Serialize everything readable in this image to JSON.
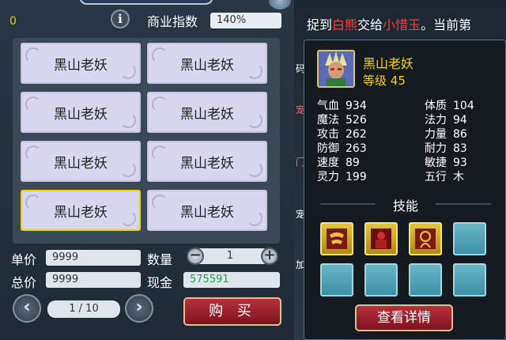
{
  "shop": {
    "top_value": "0",
    "business_index_label": "商业指数",
    "business_index_value": "140%",
    "items": [
      {
        "name": "黑山老妖"
      },
      {
        "name": "黑山老妖"
      },
      {
        "name": "黑山老妖"
      },
      {
        "name": "黑山老妖"
      },
      {
        "name": "黑山老妖"
      },
      {
        "name": "黑山老妖"
      },
      {
        "name": "黑山老妖"
      },
      {
        "name": "黑山老妖"
      }
    ],
    "selected_index": 6,
    "unit_price_label": "单价",
    "unit_price": "9999",
    "total_price_label": "总价",
    "total_price": "9999",
    "quantity_label": "数量",
    "quantity": "1",
    "cash_label": "现金",
    "cash": "575591",
    "page": "1 / 10",
    "buy_label": "购 买",
    "minus": "−",
    "plus": "+",
    "prev": "‹",
    "next": "›",
    "info": "i"
  },
  "quest": {
    "part1": "捉到",
    "target": "白熊",
    "part2": "交给",
    "npc": "小惜玉",
    "part3": "。当前第"
  },
  "monster": {
    "name": "黑山老妖",
    "level_label": "等级",
    "level": "45",
    "stats_left": [
      {
        "label": "气血",
        "value": "934"
      },
      {
        "label": "魔法",
        "value": "526"
      },
      {
        "label": "攻击",
        "value": "262"
      },
      {
        "label": "防御",
        "value": "263"
      },
      {
        "label": "速度",
        "value": "89"
      },
      {
        "label": "灵力",
        "value": "199"
      }
    ],
    "stats_right": [
      {
        "label": "体质",
        "value": "104"
      },
      {
        "label": "法力",
        "value": "94"
      },
      {
        "label": "力量",
        "value": "86"
      },
      {
        "label": "耐力",
        "value": "83"
      },
      {
        "label": "敏捷",
        "value": "93"
      },
      {
        "label": "五行",
        "value": "木"
      }
    ],
    "skills_label": "技能",
    "detail_button": "查看详情"
  },
  "background_fragments": [
    "码",
    "宠",
    "门",
    "宠",
    "加"
  ],
  "colors": {
    "accent_yellow": "#f2d400",
    "quest_red": "#ff3a3a",
    "cash_green": "#22a04a",
    "button_red": "#9a2030"
  }
}
